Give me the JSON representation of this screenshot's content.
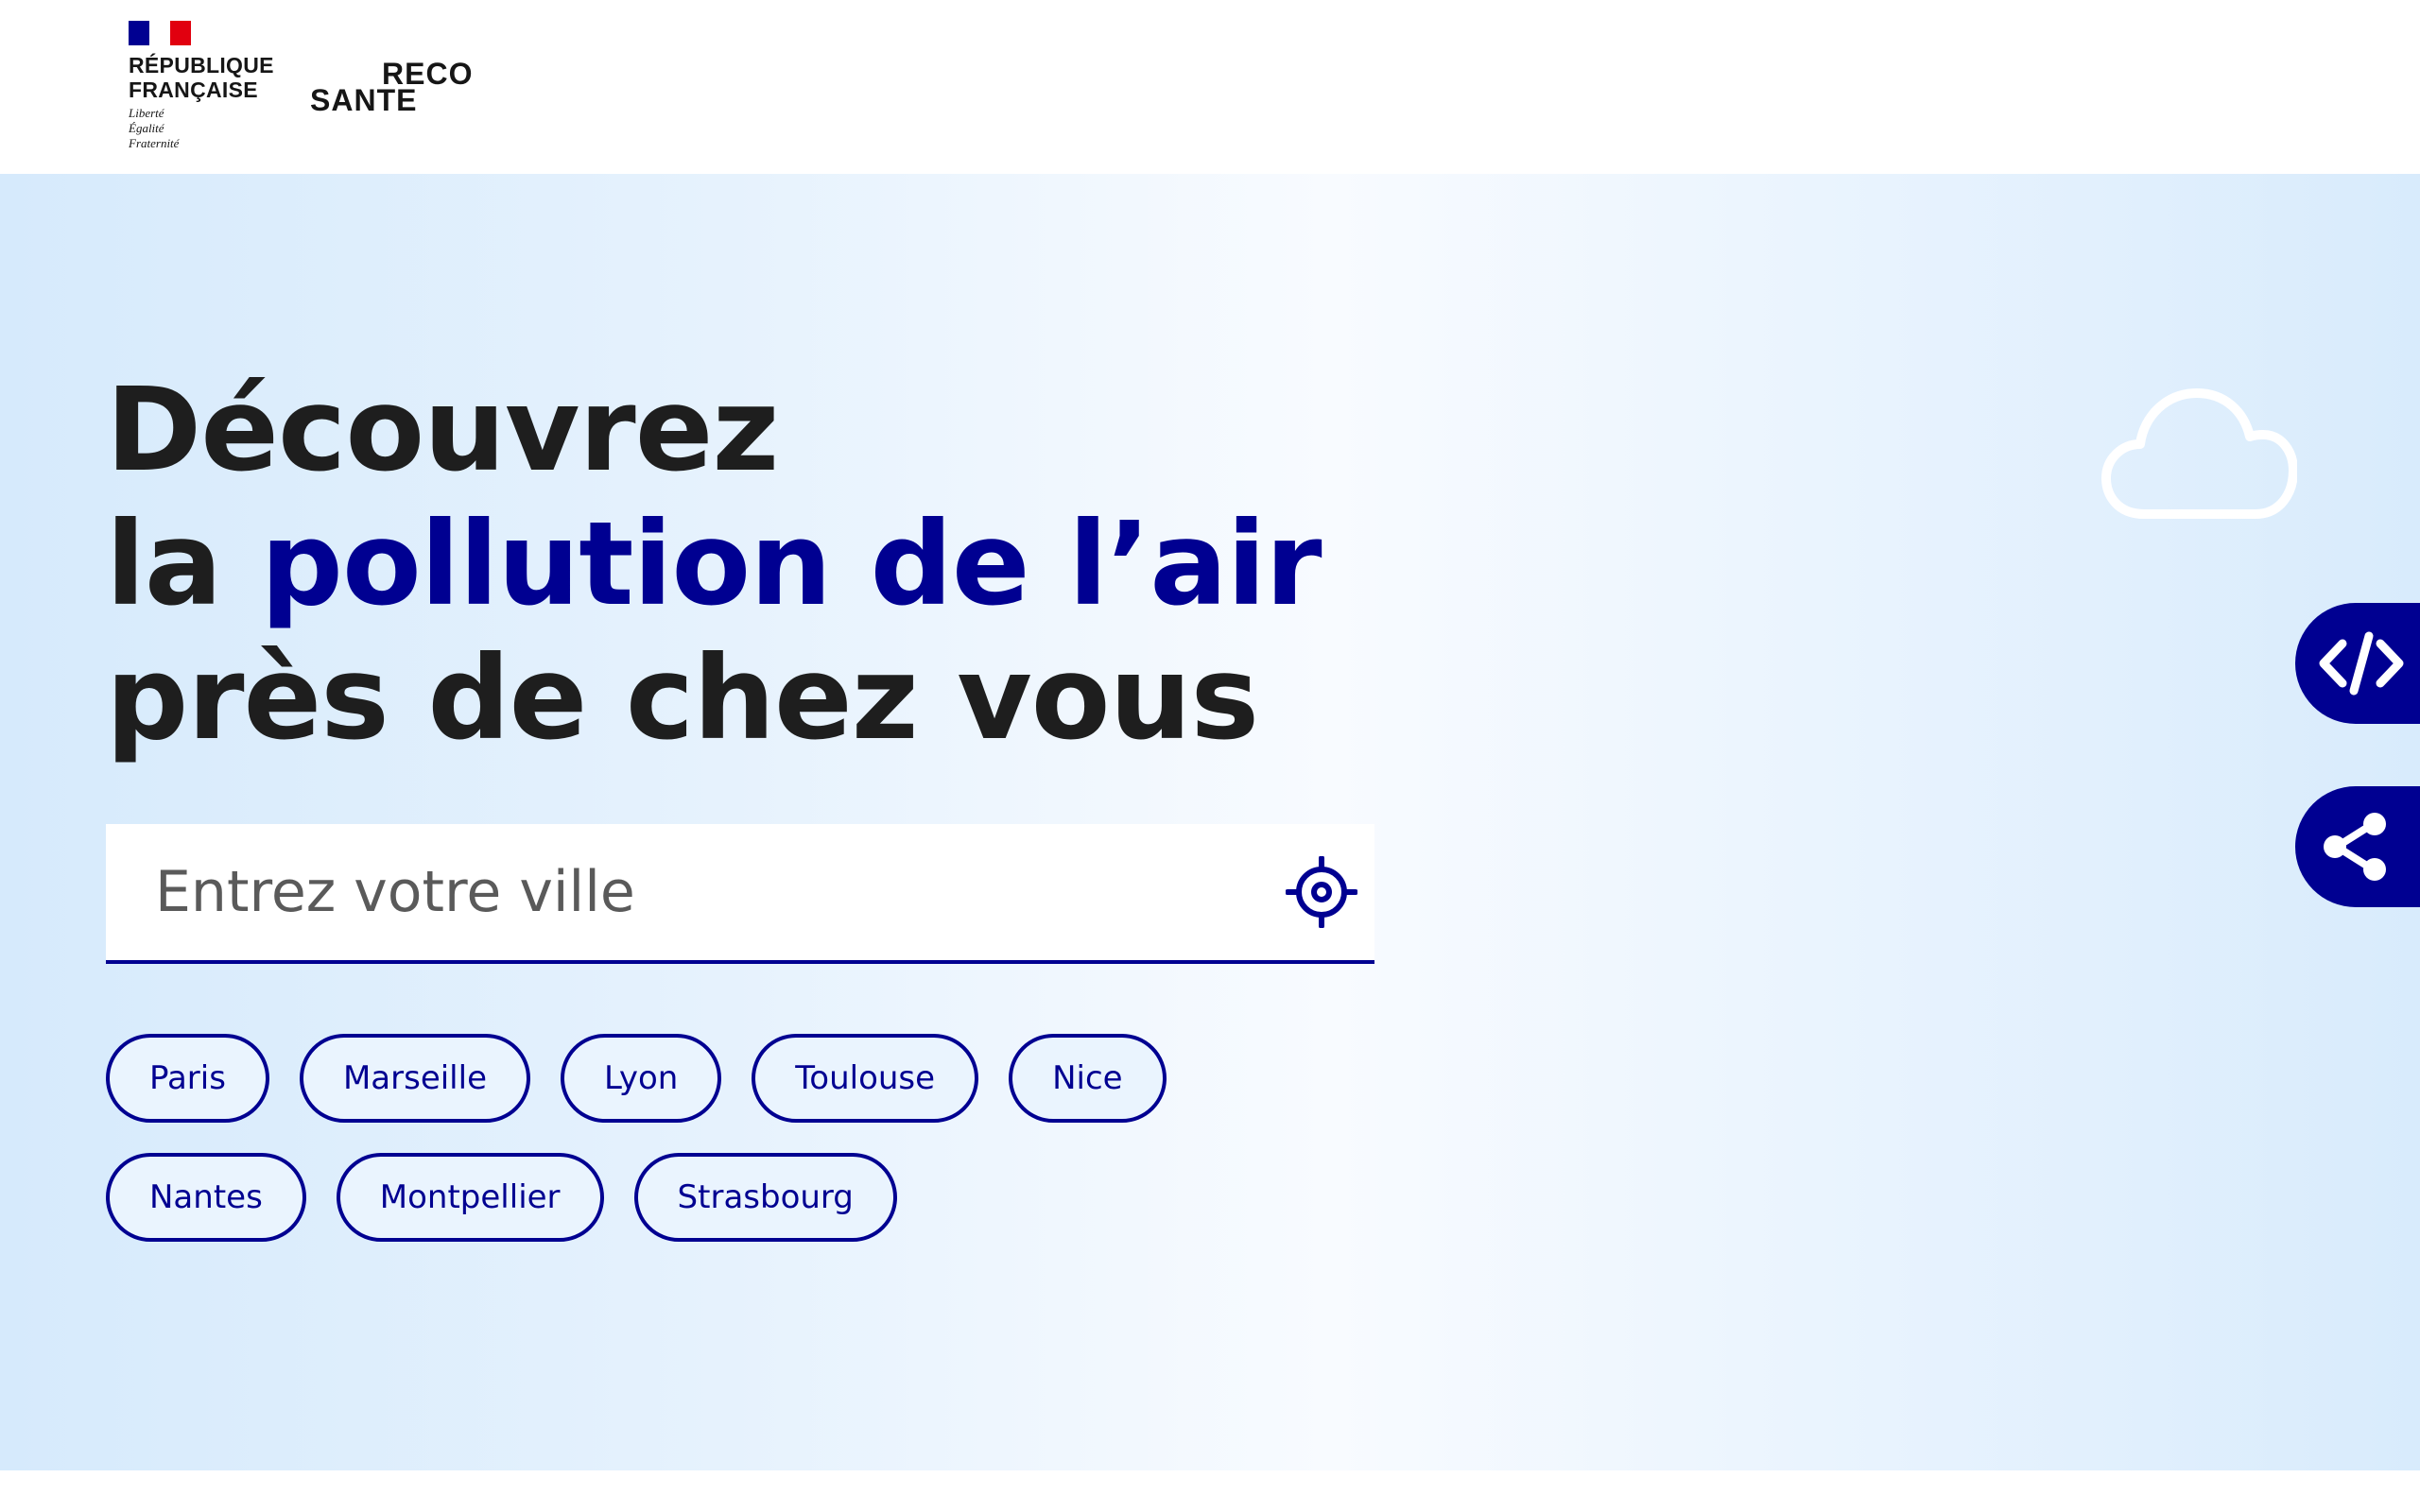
{
  "header": {
    "republique_line1": "RÉPUBLIQUE",
    "republique_line2": "FRANÇAISE",
    "motto": [
      "Liberté",
      "Égalité",
      "Fraternité"
    ],
    "brand_top": "RECO",
    "brand_bottom": "SANTE"
  },
  "hero": {
    "title_line1": "Découvrez",
    "title_line2_prefix": "la ",
    "title_line2_accent": "pollution de l’air",
    "title_line3": "près de chez vous",
    "search_placeholder": "Entrez votre ville",
    "cities_row1": [
      "Paris",
      "Marseille",
      "Lyon",
      "Toulouse",
      "Nice"
    ],
    "cities_row2": [
      "Nantes",
      "Montpellier",
      "Strasbourg"
    ]
  },
  "side_actions": {
    "embed_icon": "code-icon",
    "share_icon": "share-icon"
  },
  "colors": {
    "accent": "#000091",
    "text": "#1e1e1e",
    "flag_blue": "#000091",
    "flag_red": "#e1000f"
  }
}
